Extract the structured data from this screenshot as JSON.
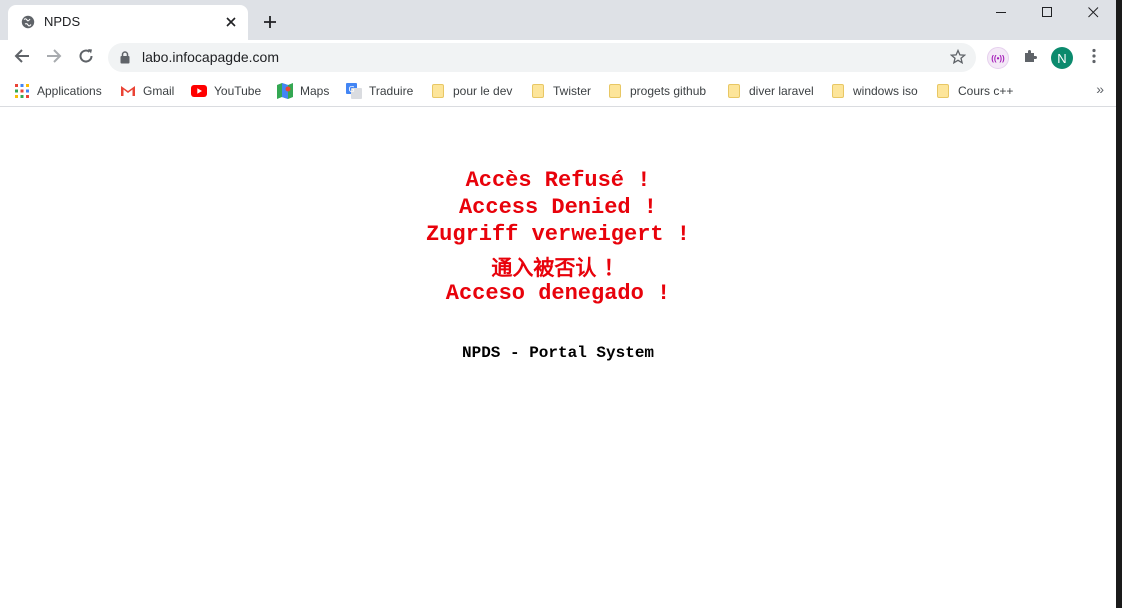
{
  "browser": {
    "tab": {
      "title": "NPDS",
      "favicon": "globe-icon"
    },
    "url": "labo.infocapagde.com",
    "profile_initial": "N",
    "ext_label": "((•))"
  },
  "bookmarks": [
    {
      "label": "Applications",
      "icon": "apps-grid-icon"
    },
    {
      "label": "Gmail",
      "icon": "gmail-icon"
    },
    {
      "label": "YouTube",
      "icon": "youtube-icon"
    },
    {
      "label": "Maps",
      "icon": "maps-icon"
    },
    {
      "label": "Traduire",
      "icon": "translate-icon"
    },
    {
      "label": "pour le dev",
      "icon": "folder-icon"
    },
    {
      "label": "Twister",
      "icon": "folder-icon"
    },
    {
      "label": "progets github",
      "icon": "folder-icon"
    },
    {
      "label": "diver laravel",
      "icon": "folder-icon"
    },
    {
      "label": "windows iso",
      "icon": "folder-icon"
    },
    {
      "label": "Cours c++",
      "icon": "folder-icon"
    }
  ],
  "page": {
    "messages": [
      "Accès Refusé !",
      "Access Denied !",
      "Zugriff verweigert !",
      "通入被否认 ！",
      "Acceso denegado !"
    ],
    "footer": "NPDS - Portal System"
  },
  "colors": {
    "denied_red": "#e8020b",
    "tabstrip": "#dee1e6",
    "omnibox": "#f1f3f4",
    "avatar": "#0b8a6d"
  }
}
